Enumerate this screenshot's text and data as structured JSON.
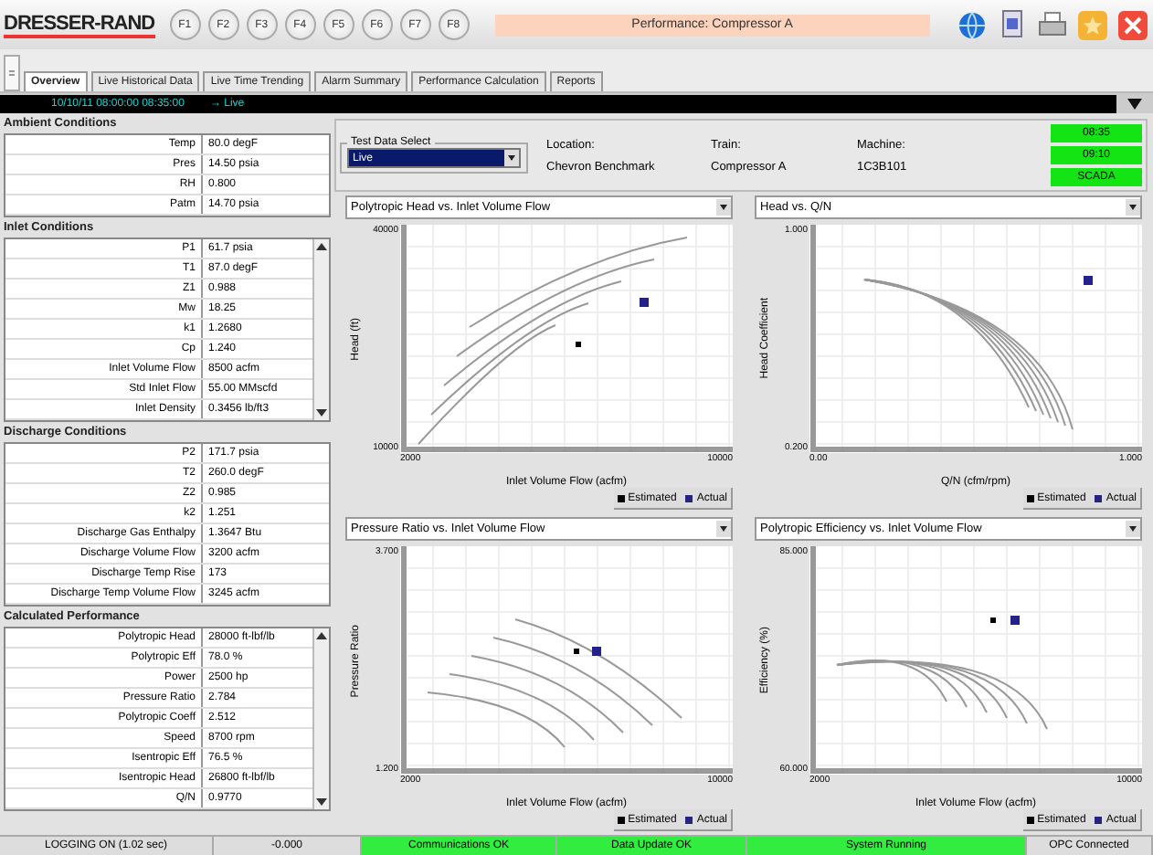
{
  "app": {
    "logo": "DRESSER-RAND",
    "function_keys": [
      "F1",
      "F2",
      "F3",
      "F4",
      "F5",
      "F6",
      "F7",
      "F8"
    ],
    "title": "Performance: Compressor A"
  },
  "tabs": [
    {
      "label": "Overview",
      "selected": true
    },
    {
      "label": "Live Historical Data",
      "selected": false
    },
    {
      "label": "Live Time Trending",
      "selected": false
    },
    {
      "label": "Alarm Summary",
      "selected": false
    },
    {
      "label": "Performance Calculation",
      "selected": false
    },
    {
      "label": "Reports",
      "selected": false
    }
  ],
  "time_bar": {
    "range": "10/10/11 08:00:00 08:35:00",
    "mode": "→ Live"
  },
  "panels": [
    {
      "title": "Ambient Conditions",
      "scrollbar": false,
      "rows": [
        {
          "label": "Temp",
          "value": "80.0 degF"
        },
        {
          "label": "Pres",
          "value": "14.50 psia"
        },
        {
          "label": "RH",
          "value": "0.800"
        },
        {
          "label": "Patm",
          "value": "14.70 psia"
        }
      ]
    },
    {
      "title": "Inlet Conditions",
      "scrollbar": true,
      "rows": [
        {
          "label": "P1",
          "value": "61.7 psia"
        },
        {
          "label": "T1",
          "value": "87.0 degF"
        },
        {
          "label": "Z1",
          "value": "0.988"
        },
        {
          "label": "Mw",
          "value": "18.25"
        },
        {
          "label": "k1",
          "value": "1.2680"
        },
        {
          "label": "Cp",
          "value": "1.240"
        },
        {
          "label": "Inlet Volume Flow",
          "value": "8500 acfm"
        },
        {
          "label": "Std Inlet Flow",
          "value": "55.00 MMscfd"
        },
        {
          "label": "Inlet Density",
          "value": "0.3456 lb/ft3"
        }
      ]
    },
    {
      "title": "Discharge Conditions",
      "scrollbar": false,
      "rows": [
        {
          "label": "P2",
          "value": "171.7 psia"
        },
        {
          "label": "T2",
          "value": "260.0 degF"
        },
        {
          "label": "Z2",
          "value": "0.985"
        },
        {
          "label": "k2",
          "value": "1.251"
        },
        {
          "label": "Discharge Gas Enthalpy",
          "value": "1.3647 Btu"
        },
        {
          "label": "Discharge Volume Flow",
          "value": "3200 acfm"
        },
        {
          "label": "Discharge Temp Rise",
          "value": "173"
        },
        {
          "label": "Discharge Temp Volume Flow",
          "value": "3245 acfm"
        }
      ]
    },
    {
      "title": "Calculated Performance",
      "scrollbar": true,
      "rows": [
        {
          "label": "Polytropic Head",
          "value": "28000 ft-lbf/lb"
        },
        {
          "label": "Polytropic Eff",
          "value": "78.0 %"
        },
        {
          "label": "Power",
          "value": "2500 hp"
        },
        {
          "label": "Pressure Ratio",
          "value": "2.784"
        },
        {
          "label": "Polytropic Coeff",
          "value": "2.512"
        },
        {
          "label": "Speed",
          "value": "8700 rpm"
        },
        {
          "label": "Isentropic Eff",
          "value": "76.5 %"
        },
        {
          "label": "Isentropic Head",
          "value": "26800 ft-lbf/lb"
        },
        {
          "label": "Q/N",
          "value": "0.9770"
        }
      ]
    }
  ],
  "test_select": {
    "legend": "Test Data Select",
    "value": "Live"
  },
  "info": [
    {
      "label": "Location:",
      "value": "Chevron Benchmark"
    },
    {
      "label": "Train:",
      "value": "Compressor A"
    },
    {
      "label": "Machine:",
      "value": "1C3B101"
    }
  ],
  "indicators": [
    "08:35",
    "09:10",
    "SCADA"
  ],
  "charts": [
    {
      "kind": "rising",
      "selector": "Polytropic Head vs. Inlet Volume Flow",
      "y_label": "Head (ft)",
      "y_ticks": [
        "40000",
        "10000"
      ],
      "x_ticks": [
        "2000",
        "10000"
      ],
      "x_label": "Inlet Volume Flow (acfm)",
      "legend": [
        "Estimated",
        "Actual"
      ]
    },
    {
      "kind": "fan",
      "selector": "Head vs. Q/N",
      "y_label": "Head Coefficient",
      "y_ticks": [
        "1.000",
        "0.200"
      ],
      "x_ticks": [
        "0.00",
        "1.000"
      ],
      "x_label": "Q/N (cfm/rpm)",
      "legend": [
        "Estimated",
        "Actual"
      ]
    },
    {
      "kind": "falling",
      "selector": "Pressure Ratio vs. Inlet Volume Flow",
      "y_label": "Pressure Ratio",
      "y_ticks": [
        "3.700",
        "1.200"
      ],
      "x_ticks": [
        "2000",
        "10000"
      ],
      "x_label": "Inlet Volume Flow (acfm)",
      "legend": [
        "Estimated",
        "Actual"
      ]
    },
    {
      "kind": "flat",
      "selector": "Polytropic Efficiency vs. Inlet Volume Flow",
      "y_label": "Efficiency (%)",
      "y_ticks": [
        "85.000",
        "60.000"
      ],
      "x_ticks": [
        "2000",
        "10000"
      ],
      "x_label": "Inlet Volume Flow (acfm)",
      "legend": [
        "Estimated",
        "Actual"
      ]
    }
  ],
  "status_bar": [
    {
      "text": "LOGGING ON (1.02 sec)",
      "kind": "plain"
    },
    {
      "text": "-0.000",
      "kind": "plain"
    },
    {
      "text": "Communications OK",
      "kind": "ok"
    },
    {
      "text": "Data Update OK",
      "kind": "ok"
    },
    {
      "text": "System Running",
      "kind": "ok"
    },
    {
      "text": "OPC Connected",
      "kind": "plain"
    }
  ]
}
